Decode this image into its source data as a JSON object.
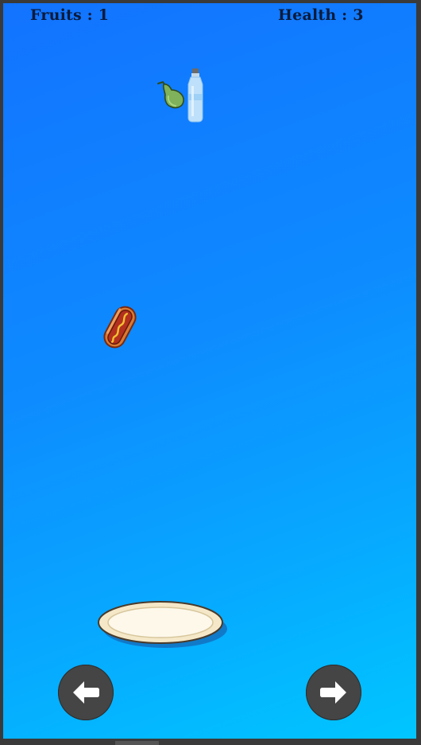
{
  "hud": {
    "fruits_text": "Fruits : 1",
    "health_text": "Health : 3",
    "fruits": 1,
    "health": 3
  },
  "items": [
    {
      "name": "pear",
      "kind": "fruit"
    },
    {
      "name": "water-bottle",
      "kind": "drink"
    },
    {
      "name": "hotdog",
      "kind": "junk-food"
    }
  ],
  "player": {
    "name": "plate"
  },
  "controls": {
    "left_icon": "arrow-left-icon",
    "right_icon": "arrow-right-icon"
  },
  "colors": {
    "sky_top": "#1273ff",
    "sky_bottom": "#00c6ff",
    "button": "#454545",
    "frame": "#3a3a3a"
  }
}
